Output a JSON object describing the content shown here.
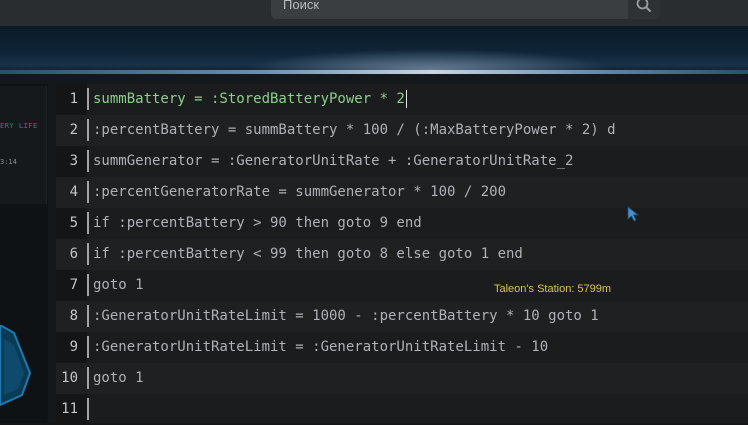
{
  "search": {
    "placeholder": "Поиск"
  },
  "left_panel": {
    "battery_label": "ERY LIFE",
    "time": "3:14"
  },
  "editor": {
    "lines": [
      {
        "num": "1",
        "code": "summBattery = :StoredBatteryPower * 2"
      },
      {
        "num": "2",
        "code": ":percentBattery = summBattery * 100 / (:MaxBatteryPower * 2) d"
      },
      {
        "num": "3",
        "code": "summGenerator = :GeneratorUnitRate + :GeneratorUnitRate_2"
      },
      {
        "num": "4",
        "code": ":percentGeneratorRate = summGenerator * 100 / 200"
      },
      {
        "num": "5",
        "code": "if :percentBattery > 90 then goto 9 end"
      },
      {
        "num": "6",
        "code": "if :percentBattery < 99 then goto 8 else goto 1 end"
      },
      {
        "num": "7",
        "code": "goto 1"
      },
      {
        "num": "8",
        "code": ":GeneratorUnitRateLimit = 1000 - :percentBattery * 10 goto 1"
      },
      {
        "num": "9",
        "code": ":GeneratorUnitRateLimit = :GeneratorUnitRateLimit - 10"
      },
      {
        "num": "10",
        "code": "goto 1"
      },
      {
        "num": "11",
        "code": ""
      }
    ]
  },
  "hud": {
    "station_label": "Taleon's Station: 5799m"
  },
  "colors": {
    "active_code": "#8ecf8b",
    "code": "#aeb2b6",
    "station": "#d8c55a"
  }
}
